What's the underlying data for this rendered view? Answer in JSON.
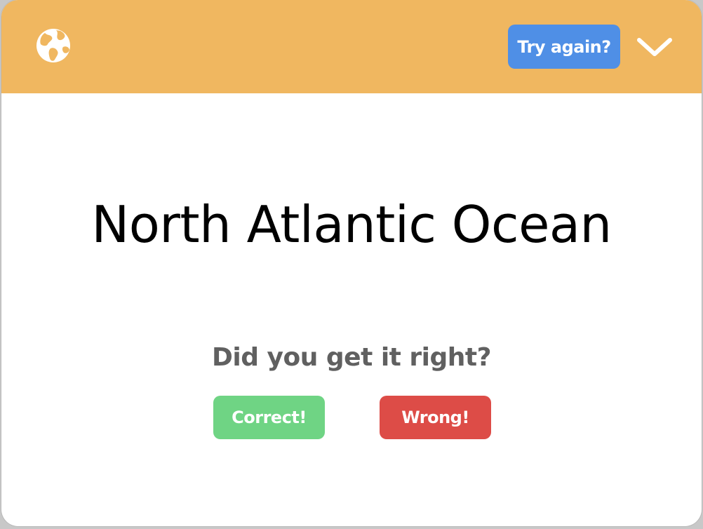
{
  "colors": {
    "header_bg": "#f0b760",
    "try_again_bg": "#4f8fe6",
    "correct_bg": "#6fd484",
    "wrong_bg": "#dd4c47",
    "icon_color": "#ffffff"
  },
  "header": {
    "globe_icon": "globe-icon",
    "try_again_label": "Try again?",
    "collapse_icon": "chevron-down-icon"
  },
  "card": {
    "answer": "North Atlantic Ocean",
    "question": "Did you get it right?",
    "correct_label": "Correct!",
    "wrong_label": "Wrong!"
  }
}
